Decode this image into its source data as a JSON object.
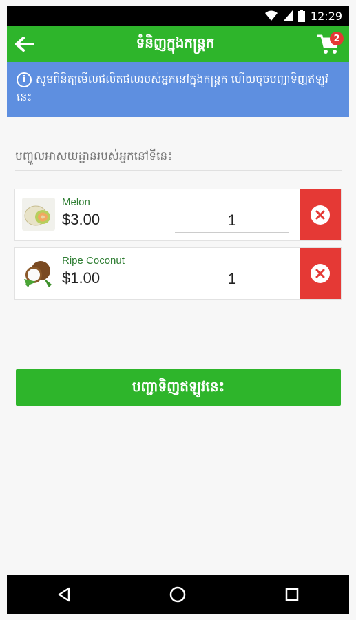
{
  "status_bar": {
    "time": "12:29",
    "icons": [
      "wifi-icon",
      "signal-icon",
      "battery-icon"
    ]
  },
  "app_bar": {
    "title": "ទំនិញក្នុងកន្ត្រក",
    "back_icon": "arrow-left-icon",
    "cart_icon": "shopping-cart-icon",
    "cart_count": "2"
  },
  "info_banner": {
    "text": "សូមពិនិត្យមើលផលិតផលរបស់អ្នកនៅក្នុងកន្ត្រក ហើយចុចបញ្ជាទិញឥឡូវនេះ"
  },
  "location_input": {
    "placeholder": "បញ្ចូលអាសយដ្ឋានរបស់អ្នកនៅទីនេះ"
  },
  "cart_items": [
    {
      "name": "Melon",
      "price": "$3.00",
      "quantity": "1",
      "image": "melon-image"
    },
    {
      "name": "Ripe Coconut",
      "price": "$1.00",
      "quantity": "1",
      "image": "coconut-image"
    }
  ],
  "order_button": {
    "label": "បញ្ជាទិញឥឡូវនេះ"
  },
  "colors": {
    "primary": "#2eb52b",
    "info_banner": "#5e8fe0",
    "remove": "#e53935",
    "badge": "#e53935",
    "item_name": "#2e7d32"
  },
  "nav_bar": [
    "back-triangle-icon",
    "home-circle-icon",
    "recents-square-icon"
  ]
}
